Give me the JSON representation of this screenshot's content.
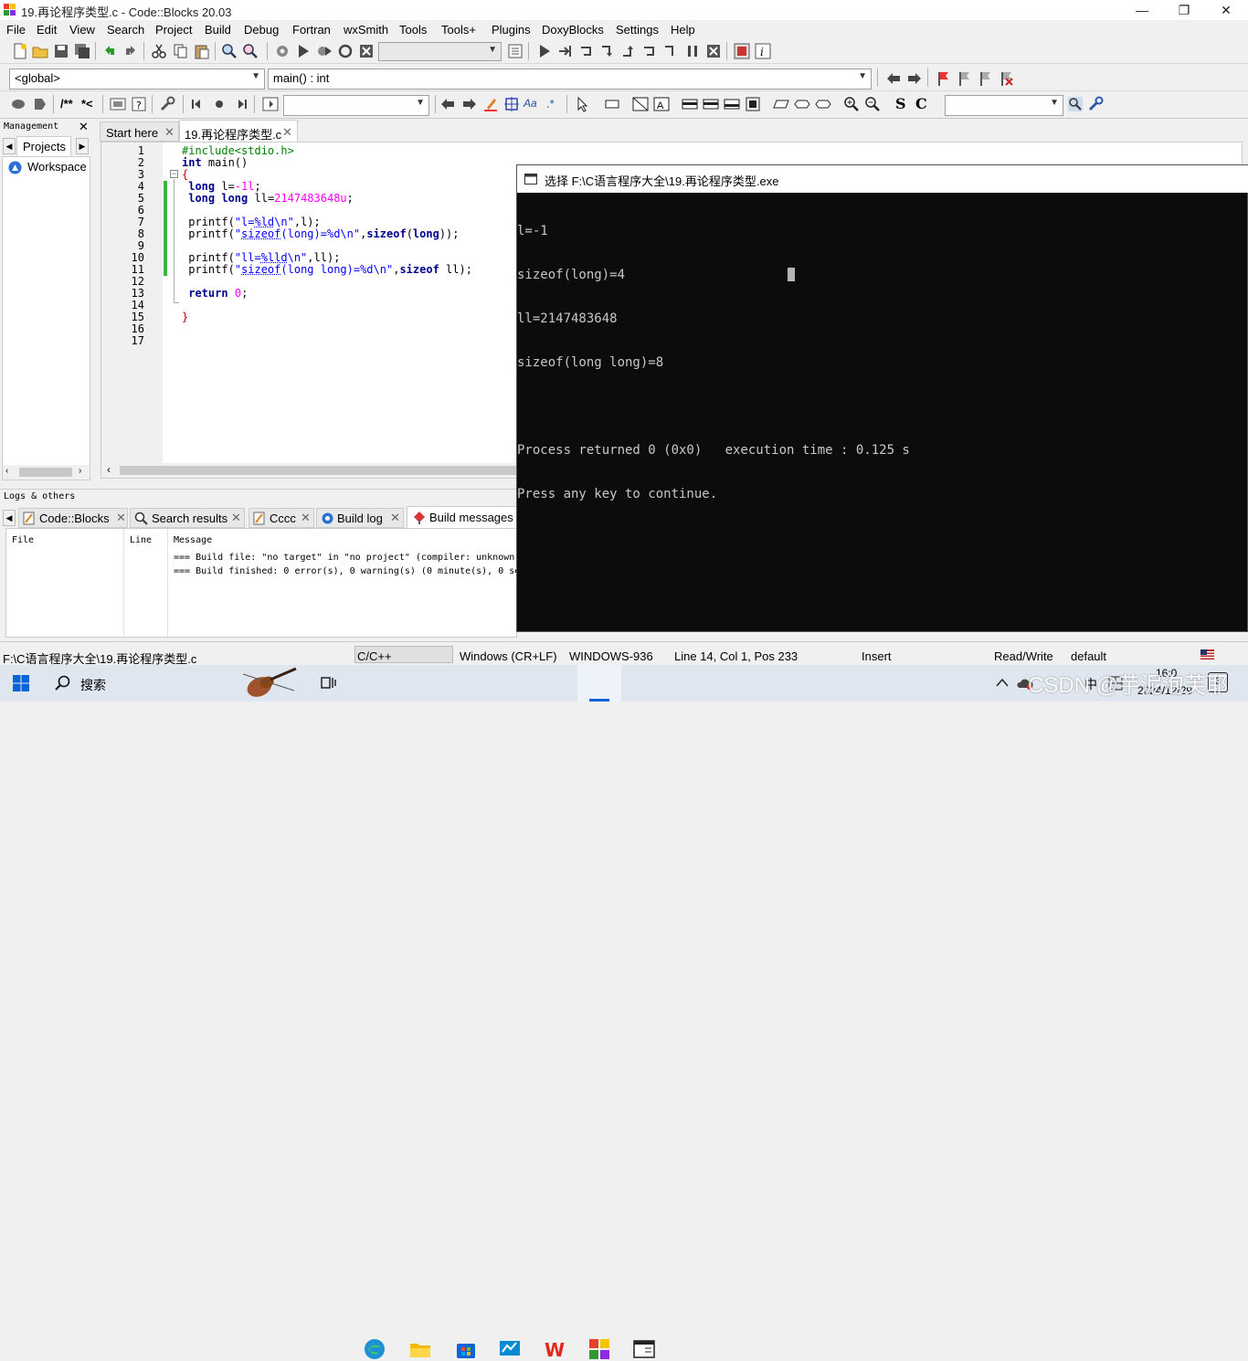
{
  "window": {
    "title": "19.再论程序类型.c - Code::Blocks 20.03",
    "minimize": "—",
    "maximize": "❐",
    "close": "✕"
  },
  "menu": [
    "File",
    "Edit",
    "View",
    "Search",
    "Project",
    "Build",
    "Debug",
    "Fortran",
    "wxSmith",
    "Tools",
    "Tools+",
    "Plugins",
    "DoxyBlocks",
    "Settings",
    "Help"
  ],
  "toolbar": {
    "scope_combo": "<global>",
    "function_combo": "main() : int",
    "doxy_comment": "/**",
    "doxy_inline": "*<",
    "s_btn": "S",
    "c_btn": "C",
    "regex": ".*",
    "aa": "Aa"
  },
  "management": {
    "title": "Management",
    "tab_projects": "Projects",
    "workspace": "Workspace"
  },
  "editor": {
    "tabs": [
      {
        "label": "Start here"
      },
      {
        "label": "19.再论程序类型.c"
      }
    ],
    "line_numbers": [
      "1",
      "2",
      "3",
      "4",
      "5",
      "6",
      "7",
      "8",
      "9",
      "10",
      "11",
      "12",
      "13",
      "14",
      "15",
      "16",
      "17"
    ]
  },
  "console": {
    "title": "选择 F:\\C语言程序大全\\19.再论程序类型.exe",
    "lines": [
      "l=-1",
      "sizeof(long)=4",
      "ll=2147483648",
      "sizeof(long long)=8",
      "",
      "Process returned 0 (0x0)   execution time : 0.125 s",
      "Press any key to continue."
    ]
  },
  "logs": {
    "title": "Logs & others",
    "tabs": [
      "Code::Blocks",
      "Search results",
      "Cccc",
      "Build log",
      "Build messages"
    ],
    "columns": [
      "File",
      "Line",
      "Message"
    ],
    "messages": [
      "=== Build file: \"no target\" in \"no project\" (compiler: unknown)",
      "=== Build finished: 0 error(s), 0 warning(s) (0 minute(s), 0 se"
    ]
  },
  "statusbar": {
    "file": "F:\\C语言程序大全\\19.再论程序类型.c",
    "language": "C/C++",
    "eol": "Windows (CR+LF)",
    "encoding": "WINDOWS-936",
    "position": "Line 14, Col 1, Pos 233",
    "mode": "Insert",
    "access": "Read/Write",
    "profile": "default"
  },
  "taskbar": {
    "search": "搜索",
    "ime": "中",
    "time": "16:0",
    "date": "2024/12/29",
    "notif_count": "3",
    "watermark": "CSDN @芋泥泡芙耶"
  },
  "colors": {
    "console_bg": "#0c0c0c",
    "taskbar_bg": "#dfe6f0",
    "change_bar": "#3ab53a"
  }
}
